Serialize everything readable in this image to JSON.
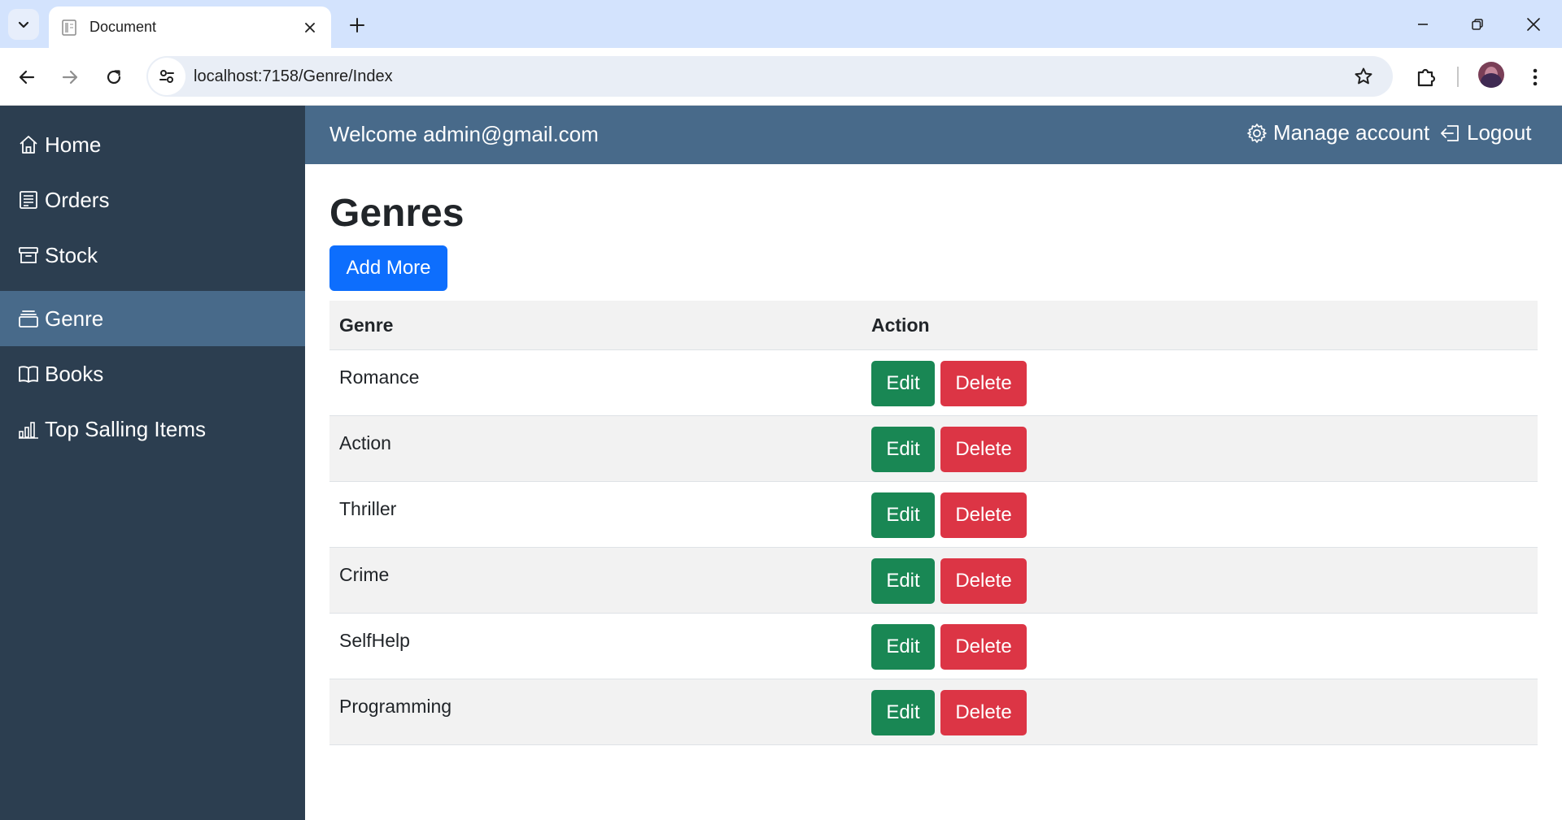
{
  "browser": {
    "tab_title": "Document",
    "url": "localhost:7158/Genre/Index"
  },
  "sidebar": {
    "items": [
      {
        "label": "Home",
        "icon": "house-icon"
      },
      {
        "label": "Orders",
        "icon": "receipt-icon"
      },
      {
        "label": "Stock",
        "icon": "archive-icon"
      },
      {
        "label": "Genre",
        "icon": "collection-icon",
        "active": true
      },
      {
        "label": "Books",
        "icon": "book-icon"
      },
      {
        "label": "Top Salling Items",
        "icon": "bar-chart-icon"
      }
    ]
  },
  "topbar": {
    "welcome": "Welcome admin@gmail.com",
    "manage_account": "Manage account",
    "logout": "Logout"
  },
  "page": {
    "title": "Genres",
    "add_button": "Add More",
    "columns": [
      "Genre",
      "Action"
    ],
    "edit_label": "Edit",
    "delete_label": "Delete",
    "rows": [
      {
        "genre": "Romance"
      },
      {
        "genre": "Action"
      },
      {
        "genre": "Thriller"
      },
      {
        "genre": "Crime"
      },
      {
        "genre": "SelfHelp"
      },
      {
        "genre": "Programming"
      }
    ]
  },
  "colors": {
    "sidebar_bg": "#2c3e50",
    "accent": "#486a8a",
    "primary": "#0d6efd",
    "success": "#198754",
    "danger": "#dc3545"
  }
}
